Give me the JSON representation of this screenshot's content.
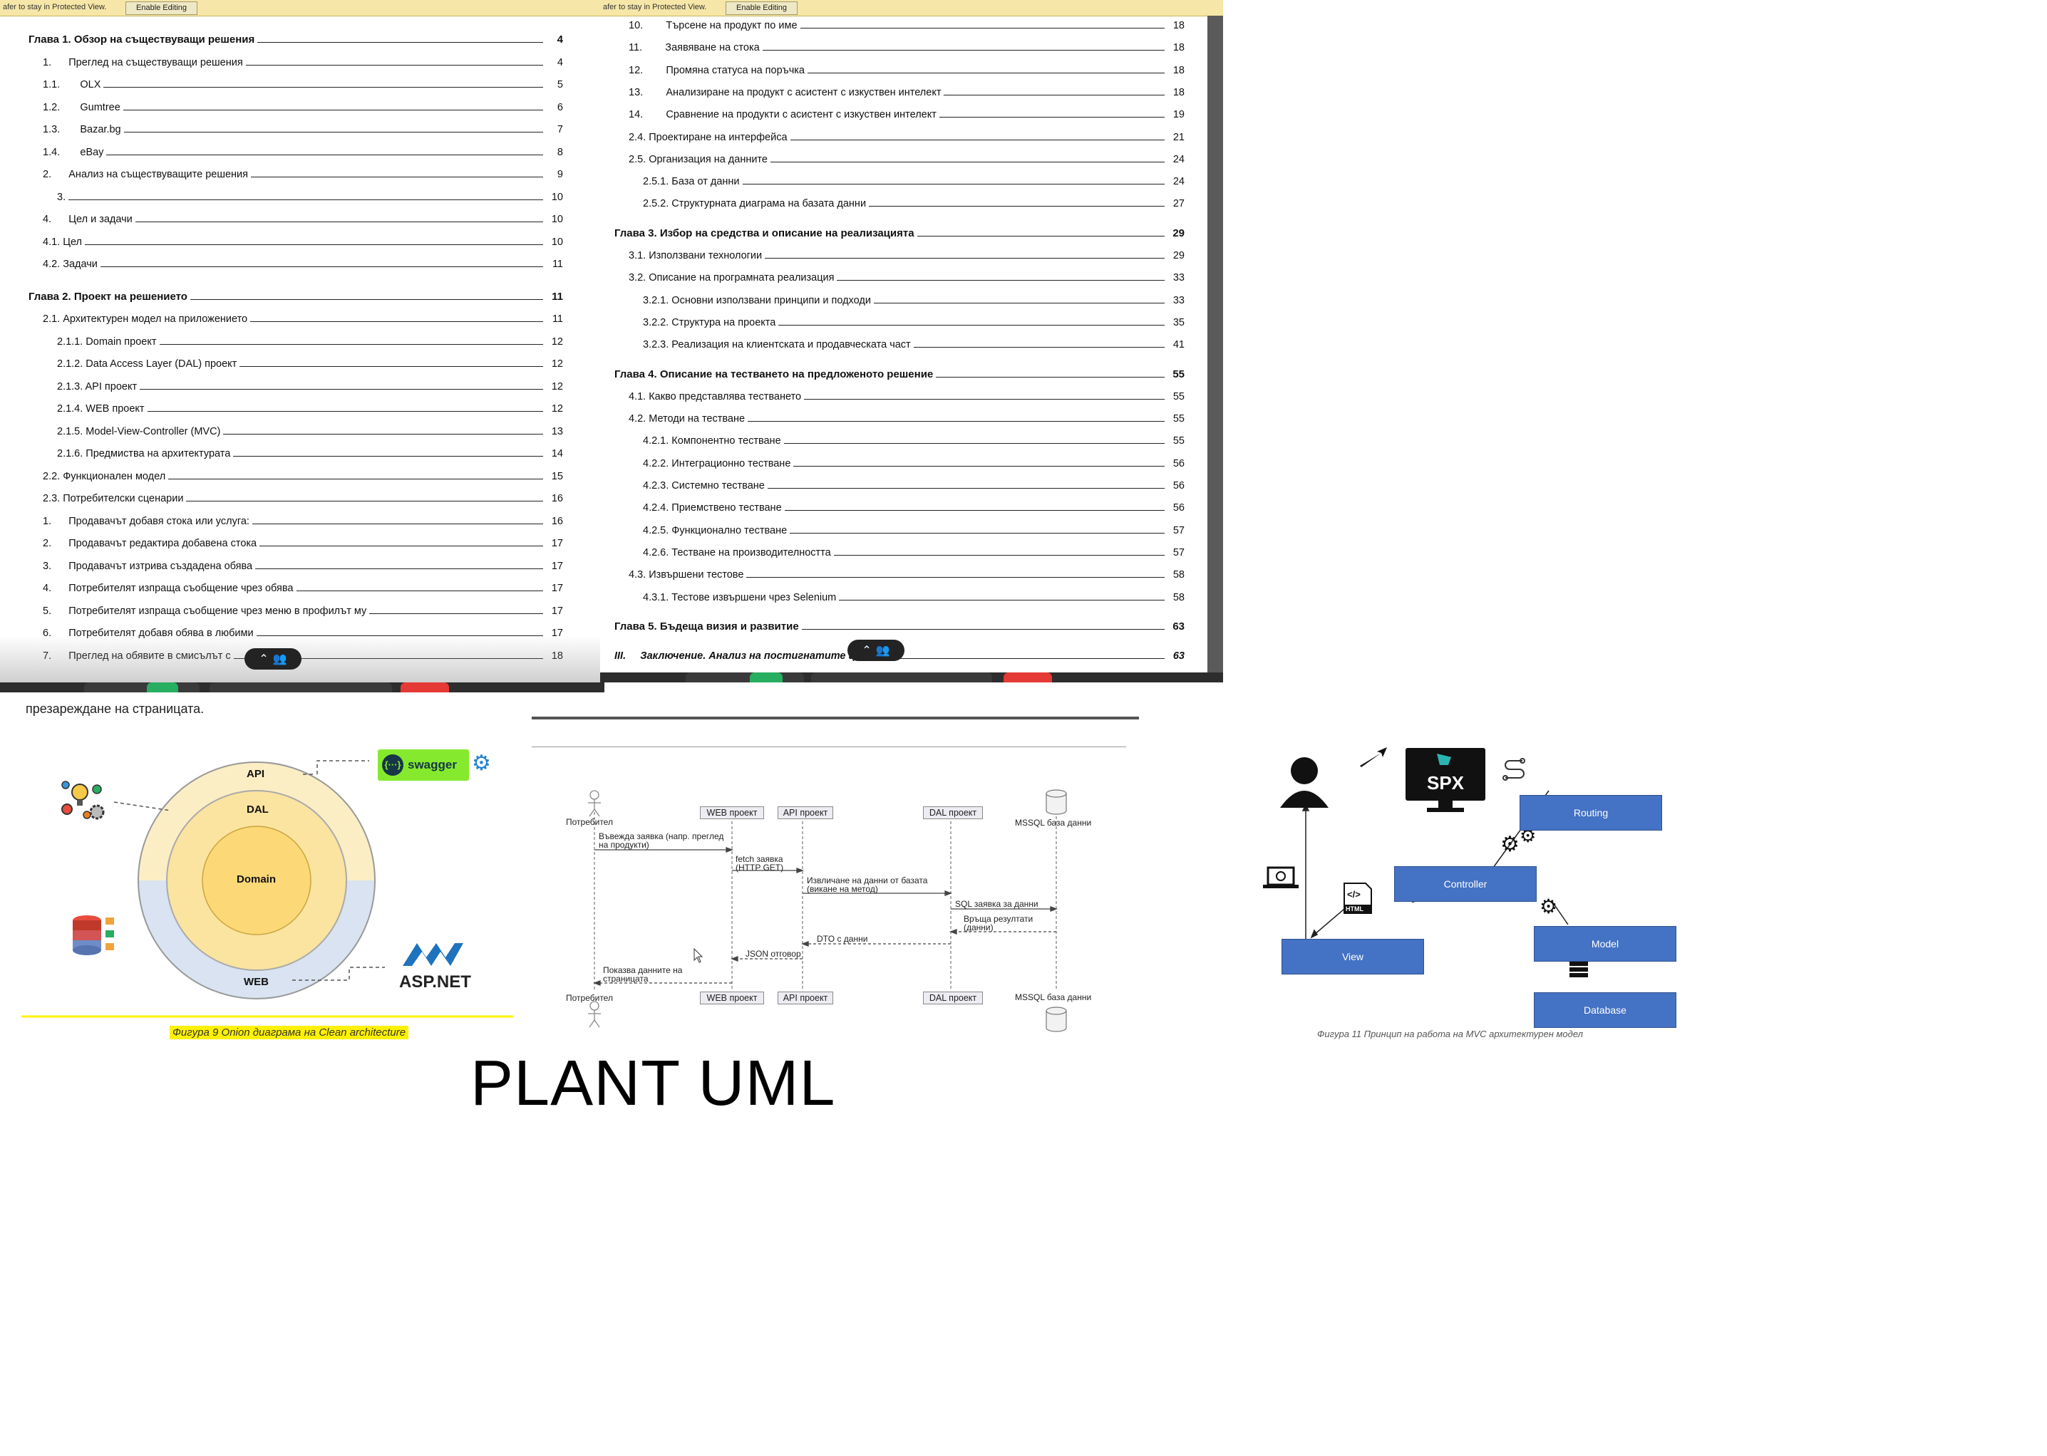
{
  "protected_view": {
    "left_text": "afer to stay in Protected View.",
    "left_button": "Enable Editing",
    "right_text": "afer to stay in Protected View.",
    "right_button": "Enable Editing"
  },
  "toc_left": [
    {
      "text": "Глава 1. Обзор на съществуващи решения",
      "page": "4",
      "style": "h"
    },
    {
      "text": "1.      Преглед на съществуващи решения",
      "page": "4",
      "style": ""
    },
    {
      "text": "1.1.       OLX",
      "page": "5",
      "style": ""
    },
    {
      "text": "1.2.       Gumtree",
      "page": "6",
      "style": ""
    },
    {
      "text": "1.3.       Bazar.bg",
      "page": "7",
      "style": ""
    },
    {
      "text": "1.4.       eBay",
      "page": "8",
      "style": ""
    },
    {
      "text": "2.      Анализ на съществуващите решения",
      "page": "9",
      "style": ""
    },
    {
      "text": "3.",
      "page": "10",
      "style": ""
    },
    {
      "text": "4.      Цел и задачи",
      "page": "10",
      "style": ""
    },
    {
      "text": "4.1. Цел",
      "page": "10",
      "style": ""
    },
    {
      "text": "4.2. Задачи",
      "page": "11",
      "style": ""
    },
    {
      "text": "Глава 2. Проект на решението",
      "page": "11",
      "style": "h"
    },
    {
      "text": "2.1. Архитектурен модел на приложението",
      "page": "11",
      "style": ""
    },
    {
      "text": "2.1.1. Domain проект",
      "page": "12",
      "style": ""
    },
    {
      "text": "2.1.2. Data Access Layer (DAL) проект",
      "page": "12",
      "style": ""
    },
    {
      "text": "2.1.3. API проект",
      "page": "12",
      "style": ""
    },
    {
      "text": "2.1.4. WEB проект",
      "page": "12",
      "style": ""
    },
    {
      "text": "2.1.5. Model-View-Controller (MVC)",
      "page": "13",
      "style": ""
    },
    {
      "text": "2.1.6. Предмиства на архитектурата",
      "page": "14",
      "style": ""
    },
    {
      "text": "2.2. Функционален модел",
      "page": "15",
      "style": ""
    },
    {
      "text": "2.3. Потребителски сценарии",
      "page": "16",
      "style": ""
    },
    {
      "text": "1.      Продавачът добавя стока или услуга:",
      "page": "16",
      "style": ""
    },
    {
      "text": "2.      Продавачът редактира добавена стока",
      "page": "17",
      "style": ""
    },
    {
      "text": "3.      Продавачът изтрива създадена обява",
      "page": "17",
      "style": ""
    },
    {
      "text": "4.      Потребителят изпраща съобщение чрез обява",
      "page": "17",
      "style": ""
    },
    {
      "text": "5.      Потребителят изпраща съобщение чрез меню в профилът му",
      "page": "17",
      "style": ""
    },
    {
      "text": "6.      Потребителят добавя обява в любими",
      "page": "17",
      "style": ""
    },
    {
      "text": "7.      Преглед на обявите в смисълът с",
      "page": "18",
      "style": ""
    }
  ],
  "toc_right": [
    {
      "text": "10.        Търсене на продукт по име",
      "page": "18",
      "style": ""
    },
    {
      "text": "11.        Заявяване на стока",
      "page": "18",
      "style": ""
    },
    {
      "text": "12.        Промяна статуса на поръчка",
      "page": "18",
      "style": ""
    },
    {
      "text": "13.        Анализиране на продукт с асистент с изкуствен интелект",
      "page": "18",
      "style": ""
    },
    {
      "text": "14.        Сравнение на продукти с асистент с изкуствен интелект",
      "page": "19",
      "style": ""
    },
    {
      "text": "2.4. Проектиране на интерфейса",
      "page": "21",
      "style": ""
    },
    {
      "text": "2.5. Организация на данните",
      "page": "24",
      "style": ""
    },
    {
      "text": "2.5.1. База от данни",
      "page": "24",
      "style": ""
    },
    {
      "text": "2.5.2. Структурната диаграма на базата данни",
      "page": "27",
      "style": ""
    },
    {
      "text": "Глава 3. Избор на средства и описание на реализацията",
      "page": "29",
      "style": "h"
    },
    {
      "text": "3.1. Използвани технологии",
      "page": "29",
      "style": ""
    },
    {
      "text": "3.2. Описание на програмната реализация",
      "page": "33",
      "style": ""
    },
    {
      "text": "3.2.1. Основни използвани принципи и подходи",
      "page": "33",
      "style": ""
    },
    {
      "text": "3.2.2. Структура на проекта",
      "page": "35",
      "style": ""
    },
    {
      "text": "3.2.3. Реализация на клиентската и продавческата част",
      "page": "41",
      "style": ""
    },
    {
      "text": "Глава 4. Описание на тестването на предложеното решение",
      "page": "55",
      "style": "h"
    },
    {
      "text": "4.1. Какво представлява тестването",
      "page": "55",
      "style": ""
    },
    {
      "text": "4.2. Методи на тестване",
      "page": "55",
      "style": ""
    },
    {
      "text": "4.2.1. Компонентно тестване",
      "page": "55",
      "style": ""
    },
    {
      "text": "4.2.2. Интеграционно тестване",
      "page": "56",
      "style": ""
    },
    {
      "text": "4.2.3. Системно тестване",
      "page": "56",
      "style": ""
    },
    {
      "text": "4.2.4. Приемствено тестване",
      "page": "56",
      "style": ""
    },
    {
      "text": "4.2.5. Функционално тестване",
      "page": "57",
      "style": ""
    },
    {
      "text": "4.2.6. Тестване на производителността",
      "page": "57",
      "style": ""
    },
    {
      "text": "4.3. Извършени тестове",
      "page": "58",
      "style": ""
    },
    {
      "text": "4.3.1. Тестове извършени чрез Selenium",
      "page": "58",
      "style": ""
    },
    {
      "text": "Глава 5. Бъдеща визия и развитие",
      "page": "63",
      "style": "h"
    },
    {
      "text": "III.     Заключение. Анализ на постигнатите цели",
      "page": "63",
      "style": "it"
    }
  ],
  "snippet_text": "презареждане на страницата.",
  "onion": {
    "layers": [
      "API",
      "DAL",
      "Domain",
      "WEB"
    ],
    "swagger_label": "swagger",
    "aspnet_label": "ASP.NET",
    "caption": "Фигура 9 Onion диаграма на Clean architecture"
  },
  "sequence": {
    "participants": [
      "Потребител",
      "WEB проект",
      "API проект",
      "DAL проект",
      "MSSQL база данни"
    ],
    "messages": [
      "Въвежда заявка (напр. преглед на продукти)",
      "fetch заявка (HTTP GET)",
      "Извличане на данни от базата (викане на метод)",
      "SQL заявка за данни",
      "Връща резултати (данни)",
      "DTO с данни",
      "JSON отговор",
      "Показва данните на страницата"
    ]
  },
  "plantuml_title": "PLANT UML",
  "mvc": {
    "logo": "SPX",
    "boxes": [
      "Routing",
      "Controller",
      "View",
      "Model",
      "Database"
    ],
    "html_badge": "HTML",
    "caption": "Фигура 11 Принцип на работа на MVC архитектурен модел"
  },
  "colors": {
    "mvc_box": "#4472c4",
    "highlight": "#fff200",
    "onion_outer": "#fbeec4",
    "onion_mid": "#fbe3a0",
    "onion_core": "#fcd877"
  }
}
